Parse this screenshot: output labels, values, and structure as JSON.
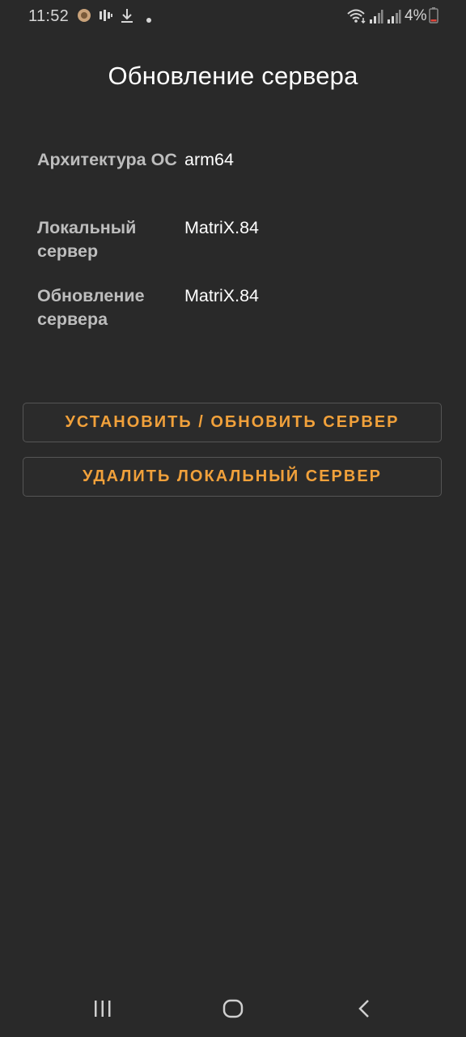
{
  "status_bar": {
    "time": "11:52",
    "battery_percent": "4%",
    "icons": [
      "app-notification-icon",
      "voicemail-icon",
      "download-icon",
      "dot-icon",
      "wifi-icon",
      "signal-icon",
      "signal-icon",
      "battery-icon"
    ]
  },
  "page": {
    "title": "Обновление сервера"
  },
  "info": {
    "rows": [
      {
        "label": "Архитектура ОС",
        "value": "arm64"
      },
      {
        "label": "Локальный сервер",
        "value": "MatriX.84"
      },
      {
        "label": "Обновление сервера",
        "value": "MatriX.84"
      }
    ]
  },
  "buttons": {
    "install_update": "УСТАНОВИТЬ / ОБНОВИТЬ СЕРВЕР",
    "remove_local": "УДАЛИТЬ ЛОКАЛЬНЫЙ СЕРВЕР"
  },
  "colors": {
    "background": "#292929",
    "accent": "#f1a13b",
    "label": "#bdbdbd",
    "value": "#ffffff"
  },
  "nav_bar": {
    "icons": [
      "recent-apps-icon",
      "home-icon",
      "back-icon"
    ]
  }
}
